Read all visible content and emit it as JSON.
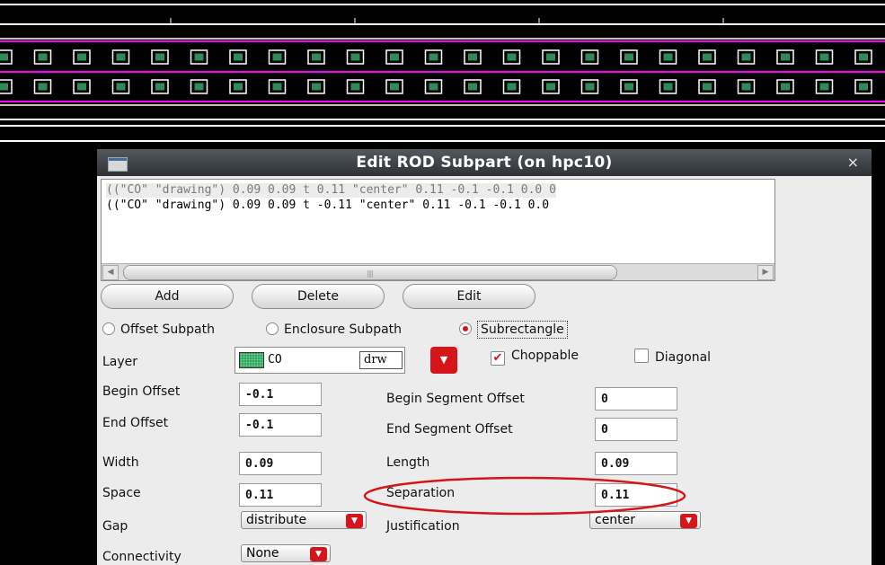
{
  "colors": {
    "accent": "#d6151a",
    "layout_bg": "#000000",
    "layout_line": "#ffffff",
    "layout_rail": "#ff00ff",
    "via_fill": "#2e8b57"
  },
  "dialog": {
    "title": "Edit ROD Subpart (on hpc10)",
    "title_icon": "window-icon",
    "close_glyph": "×",
    "list": {
      "rows": [
        "((\"CO\" \"drawing\") 0.09 0.09 t 0.11 \"center\" 0.11 -0.1 -0.1 0.0 0",
        "((\"CO\" \"drawing\") 0.09 0.09 t -0.11 \"center\" 0.11 -0.1 -0.1 0.0"
      ],
      "selected_index": 0
    },
    "buttons": {
      "add": "Add",
      "delete": "Delete",
      "edit": "Edit"
    },
    "radios": {
      "offset": "Offset Subpath",
      "enclosure": "Enclosure Subpath",
      "subrect": "Subrectangle",
      "selected": "Subrectangle"
    },
    "layer": {
      "label": "Layer",
      "name": "CO",
      "purpose": "drw"
    },
    "choppable": {
      "label": "Choppable",
      "checked": true
    },
    "diagonal": {
      "label": "Diagonal",
      "checked": false
    },
    "fields": {
      "begin_offset": {
        "label": "Begin Offset",
        "value": "-0.1"
      },
      "end_offset": {
        "label": "End Offset",
        "value": "-0.1"
      },
      "width": {
        "label": "Width",
        "value": "0.09"
      },
      "space": {
        "label": "Space",
        "value": "0.11"
      },
      "begin_segment_offset": {
        "label": "Begin Segment Offset",
        "value": "0"
      },
      "end_segment_offset": {
        "label": "End Segment Offset",
        "value": "0"
      },
      "length": {
        "label": "Length",
        "value": "0.09"
      },
      "separation": {
        "label": "Separation",
        "value": "0.11"
      }
    },
    "gap": {
      "label": "Gap",
      "value": "distribute"
    },
    "justification": {
      "label": "Justification",
      "value": "center"
    },
    "connectivity": {
      "label": "Connectivity",
      "value": "None"
    }
  }
}
